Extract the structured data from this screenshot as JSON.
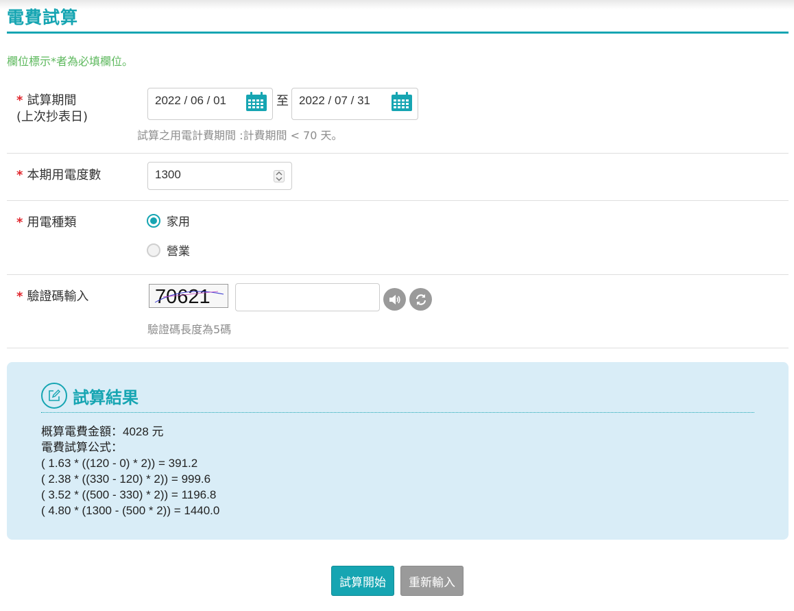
{
  "page": {
    "title": "電費試算",
    "required_note": "欄位標示*者為必填欄位。"
  },
  "period": {
    "star": "*",
    "label_line1": "試算期間",
    "label_line2": "(上次抄表日)",
    "start_date": "2022 / 06 / 01",
    "end_date": "2022 / 07 / 31",
    "separator": "至",
    "hint": "試算之用電計費期間 :計費期間 < 70 天。",
    "calendar_icon": "calendar-icon"
  },
  "usage": {
    "star": "*",
    "label": "本期用電度數",
    "value": "1300"
  },
  "type": {
    "star": "*",
    "label": "用電種類",
    "options": [
      {
        "label": "家用",
        "checked": true
      },
      {
        "label": "營業",
        "checked": false
      }
    ]
  },
  "captcha": {
    "star": "*",
    "label": "驗證碼輸入",
    "image_text": "70621",
    "input_value": "",
    "hint": "驗證碼長度為5碼",
    "audio_icon": "speaker-icon",
    "refresh_icon": "refresh-icon"
  },
  "result": {
    "title": "試算結果",
    "icon": "edit-icon",
    "lines": [
      "概算電費金額：4028 元",
      "電費試算公式：",
      "( 1.63 * ((120 - 0) * 2)) = 391.2",
      "( 2.38 * ((330 - 120) * 2)) = 999.6",
      "( 3.52 * ((500 - 330) * 2)) = 1196.8",
      "( 4.80 * (1300 - (500 * 2)) = 1440.0"
    ]
  },
  "buttons": {
    "start": "試算開始",
    "reset": "重新輸入"
  },
  "colors": {
    "accent": "#16a5b2",
    "required": "#e0262d",
    "note_green": "#5cb85c",
    "result_bg": "#d9edf7",
    "secondary_button": "#9a9a9a"
  }
}
